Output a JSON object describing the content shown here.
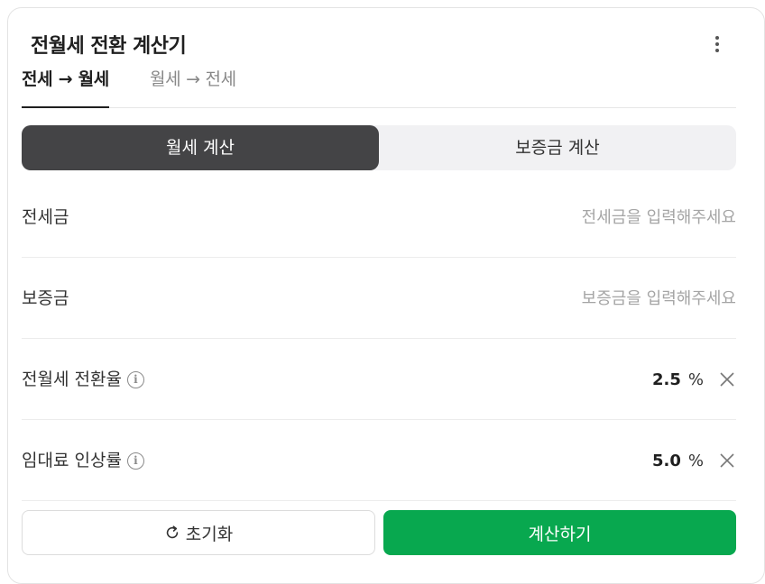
{
  "header": {
    "title": "전월세 전환 계산기"
  },
  "tabs": [
    {
      "label": "전세 → 월세",
      "active": true
    },
    {
      "label": "월세 → 전세",
      "active": false
    }
  ],
  "segment": {
    "monthly_label": "월세 계산",
    "deposit_label": "보증금 계산",
    "selected": "monthly"
  },
  "fields": {
    "jeonse": {
      "label": "전세금",
      "placeholder": "전세금을 입력해주세요",
      "value": ""
    },
    "deposit": {
      "label": "보증금",
      "placeholder": "보증금을 입력해주세요",
      "value": ""
    },
    "conversion_rate": {
      "label": "전월세 전환율",
      "value": "2.5",
      "unit": "%"
    },
    "rent_increase": {
      "label": "임대료 인상률",
      "value": "5.0",
      "unit": "%"
    }
  },
  "actions": {
    "reset_label": "초기화",
    "calc_label": "계산하기"
  },
  "colors": {
    "accent": "#08a84f",
    "segment_active": "#444446"
  },
  "icons": [
    "more-vertical-icon",
    "info-icon",
    "close-icon",
    "refresh-icon"
  ]
}
